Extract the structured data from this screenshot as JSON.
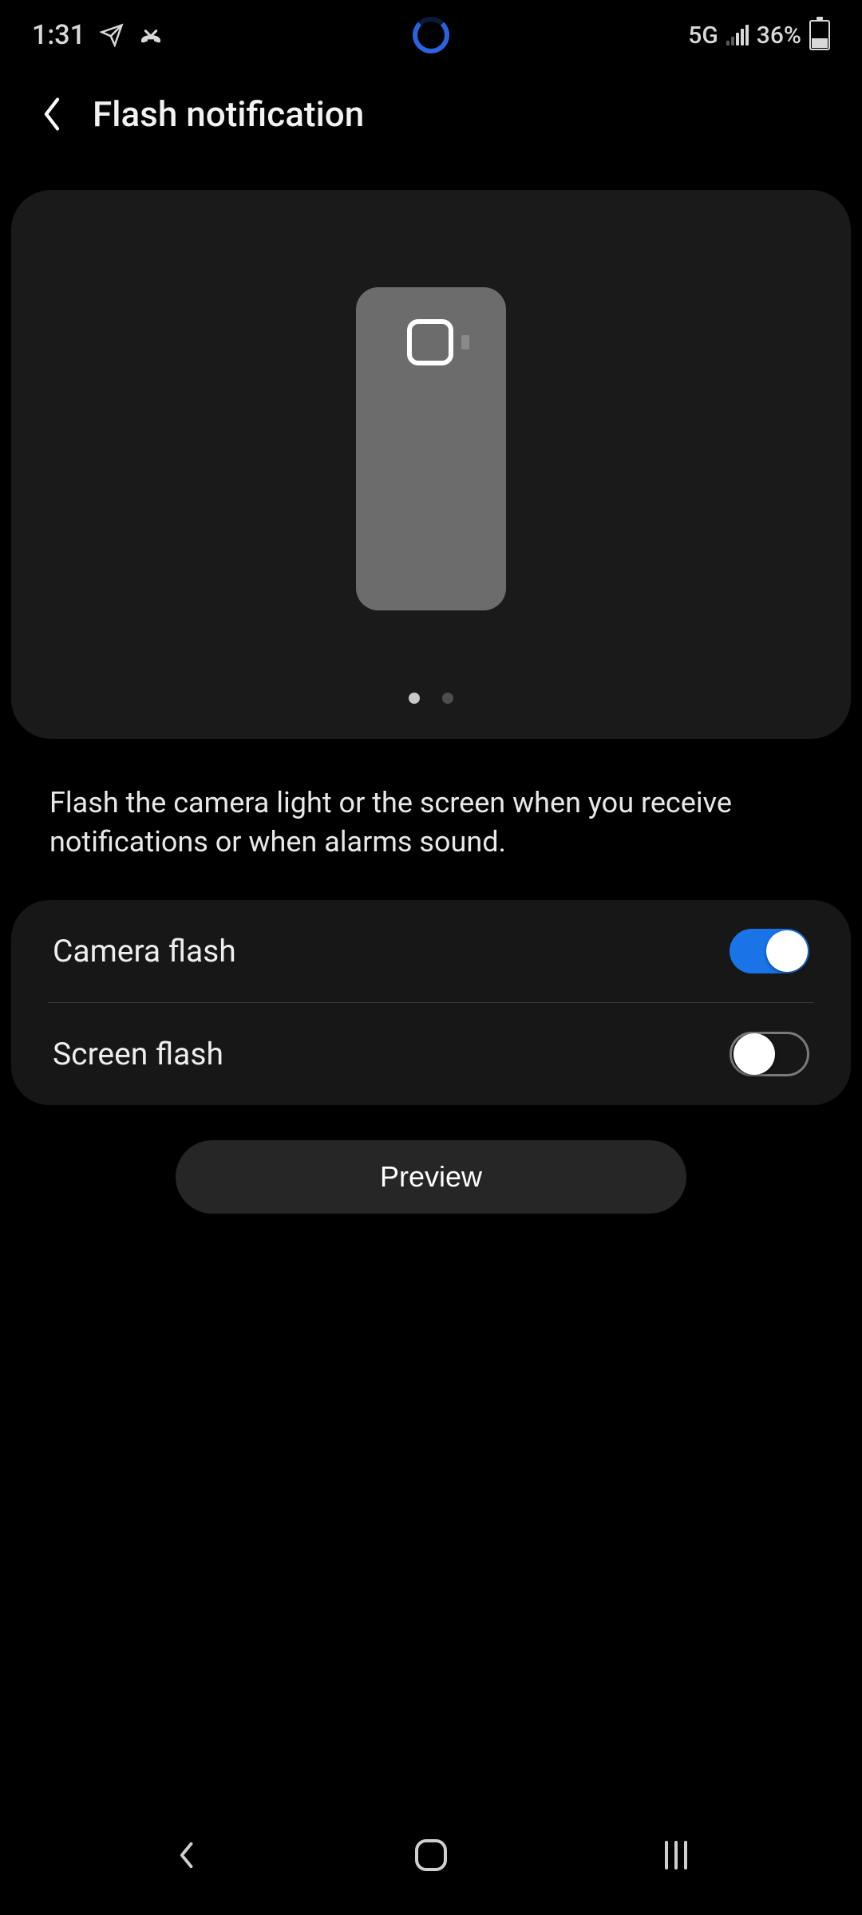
{
  "status": {
    "time": "1:31",
    "network_label": "5G",
    "battery_pct": "36%"
  },
  "header": {
    "title": "Flash notification"
  },
  "preview": {
    "pager_active_index": 0,
    "pager_count": 2
  },
  "description": "Flash the camera light or the screen when you receive notifications or when alarms sound.",
  "settings": {
    "camera_flash": {
      "label": "Camera flash",
      "enabled": true
    },
    "screen_flash": {
      "label": "Screen flash",
      "enabled": false
    }
  },
  "buttons": {
    "preview": "Preview"
  }
}
